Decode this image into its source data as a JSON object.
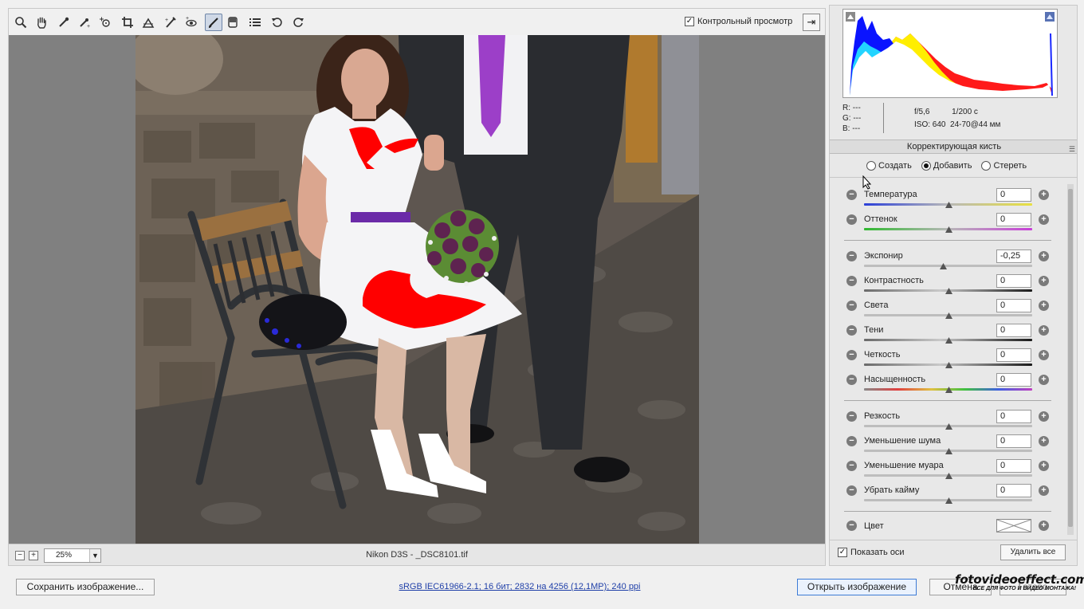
{
  "toolbar": {
    "tools": [
      {
        "name": "zoom-tool",
        "icon": "magnifier-icon"
      },
      {
        "name": "hand-tool",
        "icon": "hand-icon"
      },
      {
        "name": "white-balance-tool",
        "icon": "eyedropper-icon"
      },
      {
        "name": "color-sampler-tool",
        "icon": "color-sampler-icon"
      },
      {
        "name": "targeted-adjustment-tool",
        "icon": "target-icon"
      },
      {
        "name": "crop-tool",
        "icon": "crop-icon"
      },
      {
        "name": "straighten-tool",
        "icon": "straighten-icon"
      },
      {
        "name": "spot-removal-tool",
        "icon": "brush-heal-icon"
      },
      {
        "name": "red-eye-tool",
        "icon": "red-eye-icon"
      },
      {
        "name": "adjustment-brush-tool",
        "icon": "brush-icon",
        "active": true
      },
      {
        "name": "graduated-filter-tool",
        "icon": "graduated-filter-icon"
      },
      {
        "name": "preferences-tool",
        "icon": "list-icon"
      },
      {
        "name": "rotate-ccw-tool",
        "icon": "rotate-left-icon"
      },
      {
        "name": "rotate-cw-tool",
        "icon": "rotate-right-icon"
      }
    ],
    "preview_label": "Контрольный просмотр",
    "preview_checked": true
  },
  "status": {
    "zoom": "25%",
    "file": "Nikon D3S  -  _DSC8101.tif"
  },
  "info": {
    "r": "R:  ---",
    "g": "G:  ---",
    "b": "B:  ---",
    "aperture": "f/5,6",
    "shutter": "1/200 с",
    "iso": "ISO: 640",
    "lens": "24-70@44 мм"
  },
  "panel": {
    "title": "Корректирующая кисть",
    "modes": [
      {
        "label": "Создать",
        "selected": false
      },
      {
        "label": "Добавить",
        "selected": true
      },
      {
        "label": "Стереть",
        "selected": false
      }
    ],
    "sliders": [
      {
        "label": "Температура",
        "value": "0",
        "pos": 0.5,
        "track": "temp"
      },
      {
        "label": "Оттенок",
        "value": "0",
        "pos": 0.5,
        "track": "tint"
      },
      {
        "label": "Экспонир",
        "value": "-0,25",
        "pos": 0.47,
        "track": "plain"
      },
      {
        "label": "Контрастность",
        "value": "0",
        "pos": 0.5,
        "track": "dark"
      },
      {
        "label": "Света",
        "value": "0",
        "pos": 0.5,
        "track": "plain"
      },
      {
        "label": "Тени",
        "value": "0",
        "pos": 0.5,
        "track": "dark"
      },
      {
        "label": "Четкость",
        "value": "0",
        "pos": 0.5,
        "track": "dark"
      },
      {
        "label": "Насыщенность",
        "value": "0",
        "pos": 0.5,
        "track": "sat"
      },
      {
        "label": "Резкость",
        "value": "0",
        "pos": 0.5,
        "track": "plain"
      },
      {
        "label": "Уменьшение шума",
        "value": "0",
        "pos": 0.5,
        "track": "plain"
      },
      {
        "label": "Уменьшение муара",
        "value": "0",
        "pos": 0.5,
        "track": "plain"
      },
      {
        "label": "Убрать кайму",
        "value": "0",
        "pos": 0.5,
        "track": "plain"
      }
    ],
    "color_label": "Цвет",
    "show_pins_label": "Показать оси",
    "show_pins_checked": true,
    "clear_all_label": "Удалить все"
  },
  "footer": {
    "save_label": "Сохранить изображение...",
    "workflow": "sRGB IEC61966-2.1; 16 бит; 2832 на 4256 (12,1MP); 240 ppi",
    "open_label": "Открыть изображение",
    "cancel_label": "Отмена",
    "done_label": "Готово"
  },
  "watermark": {
    "main": "fotovideoeffect.com",
    "sub": "ВСЕ ДЛЯ ФОТО И ВИДЕО МОНТАЖА!"
  },
  "colors": {
    "mask_overlay": "#ff0000",
    "dress": "#f4f4f6",
    "tie": "#9c3fc8",
    "suit": "#2a2c30"
  }
}
